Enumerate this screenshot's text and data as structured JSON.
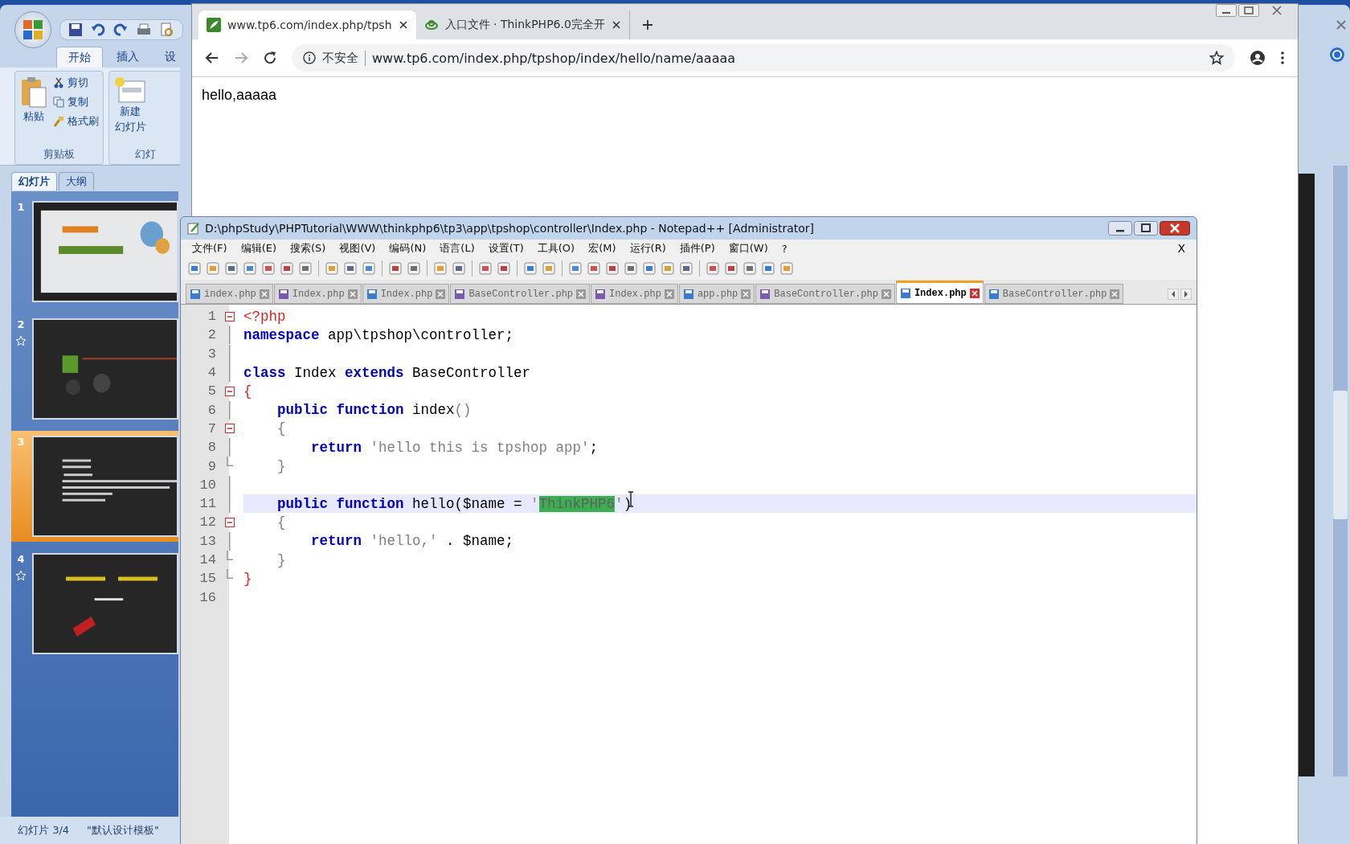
{
  "powerpoint": {
    "ribbon_tabs": [
      {
        "label": "开始",
        "selected": true
      },
      {
        "label": "插入",
        "selected": false
      },
      {
        "label": "设",
        "selected": false
      }
    ],
    "clipboard": {
      "paste": "粘贴",
      "cut": "剪切",
      "copy": "复制",
      "format_painter": "格式刷",
      "group": "剪贴板"
    },
    "slides_group": {
      "new_slide_1": "新建",
      "new_slide_2": "幻灯片",
      "group": "幻灯"
    },
    "panel_tabs": [
      {
        "label": "幻灯片",
        "selected": true
      },
      {
        "label": "大纲",
        "selected": false
      }
    ],
    "slides": [
      {
        "number": "1",
        "selected": false,
        "animated": false,
        "kind": "light"
      },
      {
        "number": "2",
        "selected": false,
        "animated": true,
        "kind": "dark"
      },
      {
        "number": "3",
        "selected": true,
        "animated": false,
        "kind": "text"
      },
      {
        "number": "4",
        "selected": false,
        "animated": true,
        "kind": "dark"
      }
    ],
    "status_bar": [
      "幻灯片 3/4",
      "\"默认设计模板\""
    ]
  },
  "browser": {
    "tabs": [
      {
        "title": "www.tp6.com/index.php/tpsh",
        "selected": true
      },
      {
        "title": "入口文件 · ThinkPHP6.0完全开",
        "selected": false
      }
    ],
    "security": "不安全",
    "url": "www.tp6.com/index.php/tpshop/index/hello/name/aaaaa",
    "content": "hello,aaaaa"
  },
  "notepad": {
    "title": "D:\\phpStudy\\PHPTutorial\\WWW\\thinkphp6\\tp3\\app\\tpshop\\controller\\Index.php - Notepad++ [Administrator]",
    "menu": [
      "文件(F)",
      "编辑(E)",
      "搜索(S)",
      "视图(V)",
      "编码(N)",
      "语言(L)",
      "设置(T)",
      "工具(O)",
      "宏(M)",
      "运行(R)",
      "插件(P)",
      "窗口(W)",
      "?"
    ],
    "close_doc": "X",
    "tabs": [
      {
        "label": "index.php",
        "selected": false,
        "modified": false
      },
      {
        "label": "Index.php",
        "selected": false,
        "modified": true
      },
      {
        "label": "Index.php",
        "selected": false,
        "modified": false
      },
      {
        "label": "BaseController.php",
        "selected": false,
        "modified": true
      },
      {
        "label": "Index.php",
        "selected": false,
        "modified": true
      },
      {
        "label": "app.php",
        "selected": false,
        "modified": false
      },
      {
        "label": "BaseController.php",
        "selected": false,
        "modified": true
      },
      {
        "label": "Index.php",
        "selected": true,
        "modified": false
      },
      {
        "label": "BaseController.php",
        "selected": false,
        "modified": false
      }
    ],
    "lines": [
      {
        "number": "1",
        "kind": "open",
        "current": false,
        "tokens": [
          {
            "kind": "tag",
            "text": "<?php"
          }
        ]
      },
      {
        "number": "2",
        "kind": "line",
        "current": false,
        "tokens": [
          {
            "kind": "kw",
            "text": "namespace"
          },
          {
            "kind": "plain",
            "text": " app\\tpshop\\controller;"
          }
        ]
      },
      {
        "number": "3",
        "kind": "line",
        "current": false
      },
      {
        "number": "4",
        "kind": "line",
        "current": false,
        "tokens": [
          {
            "kind": "kw",
            "text": "class"
          },
          {
            "kind": "plain",
            "text": " Index "
          },
          {
            "kind": "kw",
            "text": "extends"
          },
          {
            "kind": "plain",
            "text": " BaseController"
          }
        ]
      },
      {
        "number": "5",
        "kind": "open",
        "current": false,
        "tokens": [
          {
            "kind": "op",
            "text": "{"
          }
        ]
      },
      {
        "number": "6",
        "kind": "line",
        "current": false,
        "tokens": [
          {
            "kind": "kw",
            "text": "    public function"
          },
          {
            "kind": "plain",
            "text": " index"
          },
          {
            "kind": "paren",
            "text": "()"
          }
        ]
      },
      {
        "number": "7",
        "kind": "open",
        "current": false,
        "tokens": [
          {
            "kind": "paren",
            "text": "    {"
          }
        ]
      },
      {
        "number": "8",
        "kind": "line",
        "current": false,
        "tokens": [
          {
            "kind": "kw",
            "text": "        return"
          },
          {
            "kind": "str",
            "text": " 'hello this is tpshop app'"
          },
          {
            "kind": "plain",
            "text": ";"
          }
        ]
      },
      {
        "number": "9",
        "kind": "end",
        "current": false,
        "tokens": [
          {
            "kind": "paren",
            "text": "    }"
          }
        ]
      },
      {
        "number": "10",
        "kind": "line",
        "current": false
      },
      {
        "number": "11",
        "kind": "line",
        "current": true,
        "tokens": [
          {
            "kind": "kw",
            "text": "    public function"
          },
          {
            "kind": "plain",
            "text": " hello($name = "
          },
          {
            "kind": "str",
            "text": "'"
          },
          {
            "kind": "selected",
            "text": "ThinkPHP6"
          },
          {
            "kind": "str",
            "text": "'"
          },
          {
            "kind": "plain",
            "text": ")"
          }
        ]
      },
      {
        "number": "12",
        "kind": "open",
        "current": false,
        "tokens": [
          {
            "kind": "paren",
            "text": "    {"
          }
        ]
      },
      {
        "number": "13",
        "kind": "line",
        "current": false,
        "tokens": [
          {
            "kind": "kw",
            "text": "        return"
          },
          {
            "kind": "str",
            "text": " 'hello,'"
          },
          {
            "kind": "plain",
            "text": " . $name;"
          }
        ]
      },
      {
        "number": "14",
        "kind": "end",
        "current": false,
        "tokens": [
          {
            "kind": "paren",
            "text": "    }"
          }
        ]
      },
      {
        "number": "15",
        "kind": "end",
        "current": false,
        "tokens": [
          {
            "kind": "op",
            "text": "}"
          }
        ]
      },
      {
        "number": "16",
        "kind": "none",
        "current": false
      }
    ]
  }
}
